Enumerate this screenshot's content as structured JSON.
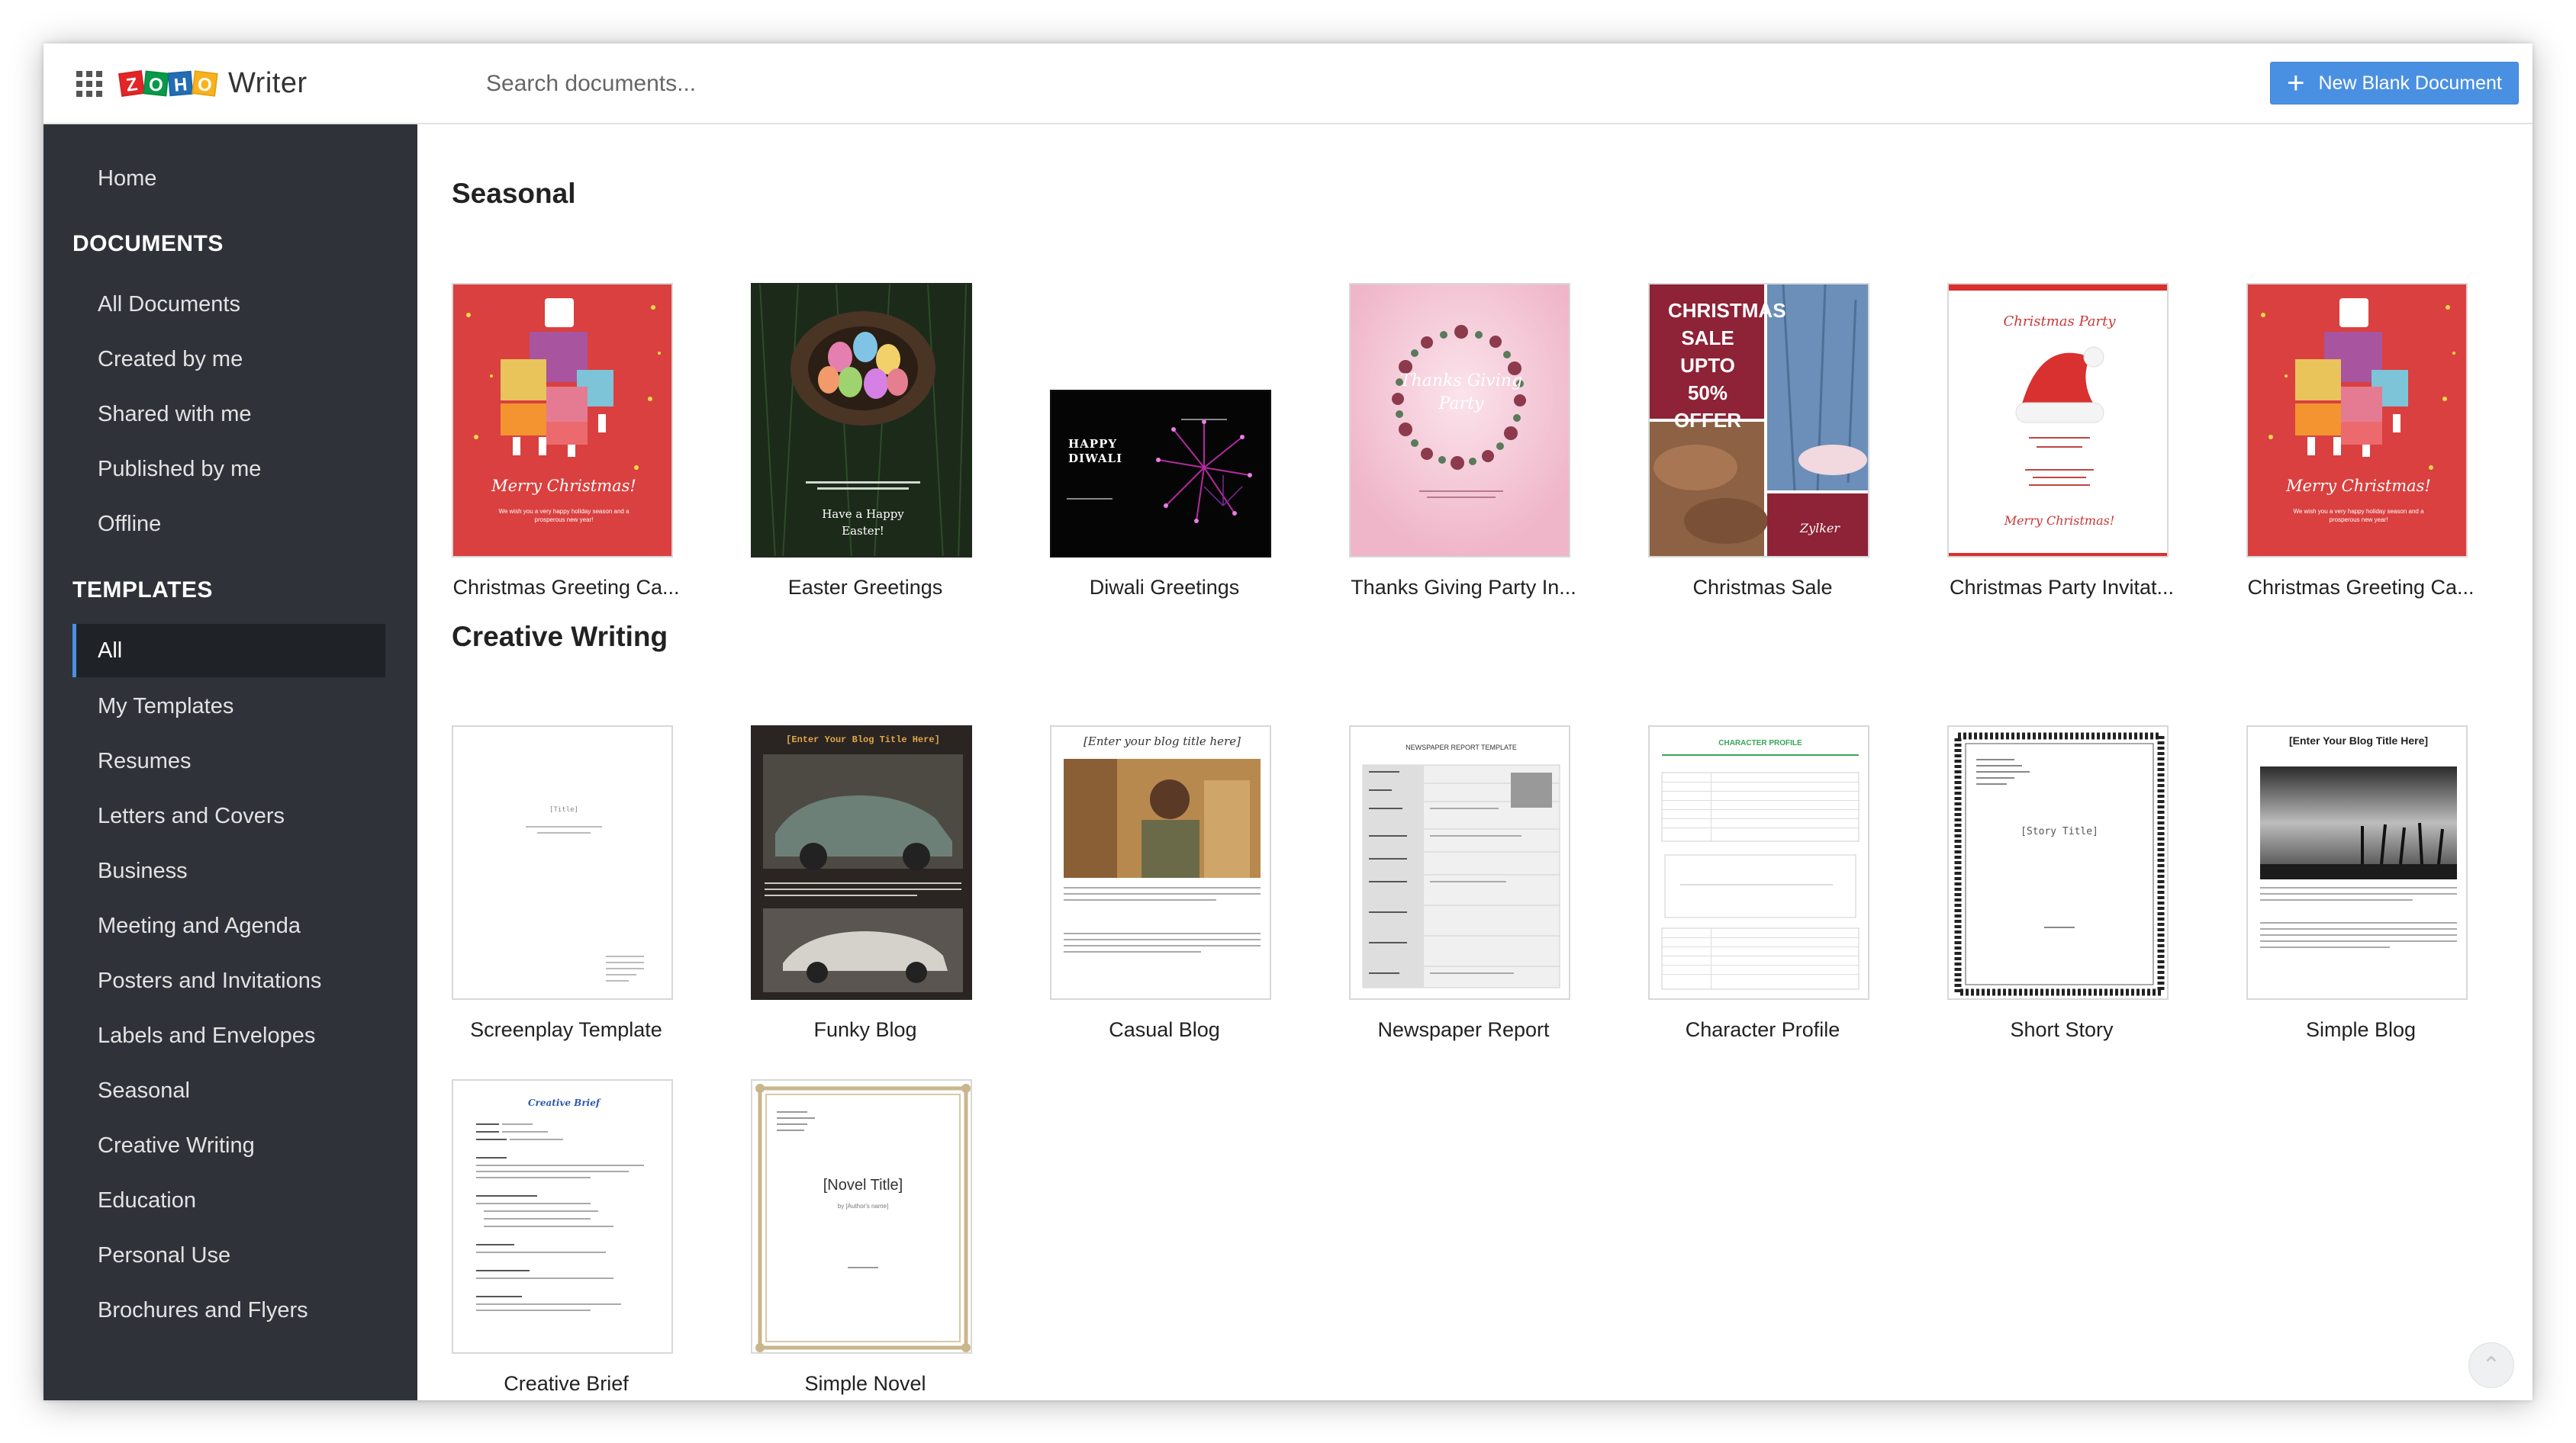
{
  "app": {
    "logo_letters": [
      "Z",
      "O",
      "H",
      "O"
    ],
    "name": "Writer"
  },
  "header": {
    "search_placeholder": "Search documents...",
    "new_button_label": "New Blank Document"
  },
  "sidebar": {
    "home": "Home",
    "documents_heading": "DOCUMENTS",
    "documents": [
      "All Documents",
      "Created by me",
      "Shared with me",
      "Published by me",
      "Offline"
    ],
    "templates_heading": "TEMPLATES",
    "templates": [
      "All",
      "My Templates",
      "Resumes",
      "Letters and Covers",
      "Business",
      "Meeting and Agenda",
      "Posters and Invitations",
      "Labels and Envelopes",
      "Seasonal",
      "Creative Writing",
      "Education",
      "Personal Use",
      "Brochures and Flyers"
    ],
    "active_template": "All"
  },
  "sections": [
    {
      "title": "Seasonal",
      "items": [
        {
          "label": "Christmas Greeting Ca...",
          "thumb": {
            "title": "Merry Christmas!",
            "body": "We wish you a very happy holiday season and a prosperous new year!"
          }
        },
        {
          "label": "Easter Greetings",
          "thumb": {
            "title": "Have a Happy Easter!"
          }
        },
        {
          "label": "Diwali Greetings",
          "thumb": {
            "title": "HAPPY DIWALI"
          }
        },
        {
          "label": "Thanks Giving Party In...",
          "thumb": {
            "title": "Thanks Giving Party"
          }
        },
        {
          "label": "Christmas Sale",
          "thumb": {
            "title": "CHRISTMAS SALE UPTO 50% OFFER",
            "brand": "Zylker"
          }
        },
        {
          "label": "Christmas Party Invitat...",
          "thumb": {
            "title": "Christmas Party",
            "subtitle": "Merry Christmas!"
          }
        },
        {
          "label": "Christmas Greeting Ca...",
          "thumb": {
            "title": "Merry Christmas!",
            "body": "We wish you a very happy holiday season and a prosperous new year!"
          }
        }
      ]
    },
    {
      "title": "Creative Writing",
      "items": [
        {
          "label": "Screenplay Template",
          "thumb": {
            "title": "[Title]"
          }
        },
        {
          "label": "Funky Blog",
          "thumb": {
            "title": "[Enter Your Blog Title Here]"
          }
        },
        {
          "label": "Casual Blog",
          "thumb": {
            "title": "[Enter your blog title here]"
          }
        },
        {
          "label": "Newspaper Report",
          "thumb": {
            "title": "NEWSPAPER REPORT TEMPLATE"
          }
        },
        {
          "label": "Character Profile",
          "thumb": {
            "title": "CHARACTER PROFILE"
          }
        },
        {
          "label": "Short Story",
          "thumb": {
            "title": "[Story Title]"
          }
        },
        {
          "label": "Simple Blog",
          "thumb": {
            "title": "[Enter Your Blog Title Here]"
          }
        },
        {
          "label": "Creative Brief",
          "thumb": {
            "title": "Creative Brief"
          }
        },
        {
          "label": "Simple Novel",
          "thumb": {
            "title": "[Novel Title]",
            "subtitle": "by [Author's name]"
          }
        }
      ]
    }
  ],
  "colors": {
    "accent": "#4a90e2",
    "sidebar_bg": "#2f3339",
    "christmas_red": "#d9403f"
  },
  "scroll_top_icon": "chevron-up-icon"
}
